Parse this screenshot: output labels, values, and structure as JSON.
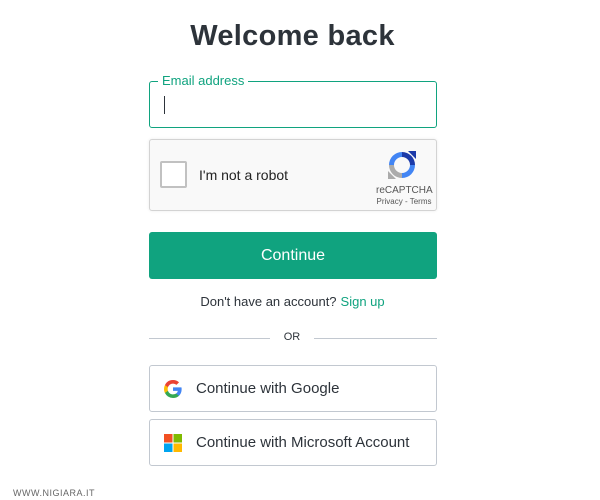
{
  "heading": "Welcome back",
  "email": {
    "label": "Email address",
    "value": ""
  },
  "recaptcha": {
    "checkbox_label": "I'm not a robot",
    "brand": "reCAPTCHA",
    "privacy": "Privacy",
    "separator": " - ",
    "terms": "Terms",
    "checked": false
  },
  "continue_button": "Continue",
  "signup": {
    "prompt": "Don't have an account?",
    "link": "Sign up"
  },
  "divider_text": "OR",
  "social": {
    "google": {
      "label": "Continue with Google",
      "icon": "google-logo-icon"
    },
    "microsoft": {
      "label": "Continue with Microsoft Account",
      "icon": "microsoft-logo-icon"
    }
  },
  "watermark": "WWW.NIGIARA.IT",
  "colors": {
    "accent": "#10a37f",
    "text": "#2d333a",
    "border": "#c2c8d0"
  }
}
